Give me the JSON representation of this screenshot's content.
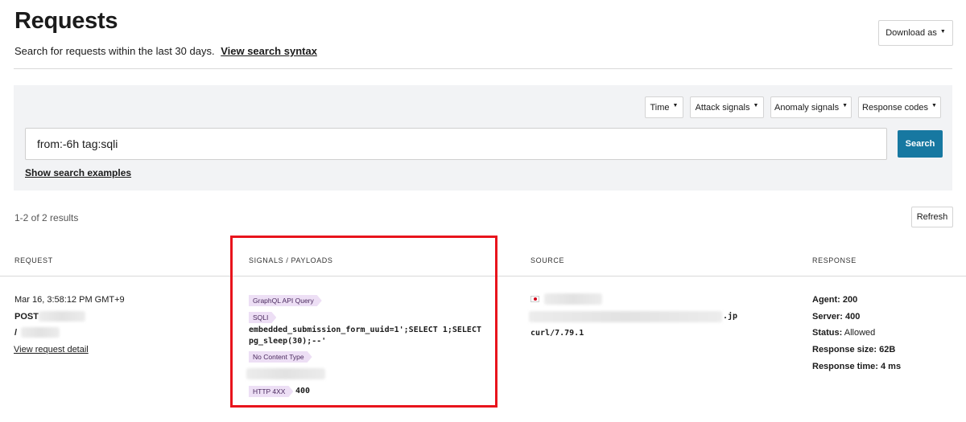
{
  "header": {
    "title": "Requests",
    "subtitle": "Search for requests within the last 30 days.",
    "syntax_link": "View search syntax",
    "download_label": "Download as"
  },
  "filters": {
    "time": "Time",
    "attack": "Attack signals",
    "anomaly": "Anomaly signals",
    "response": "Response codes"
  },
  "search": {
    "value": "from:-6h tag:sqli",
    "button": "Search",
    "examples_link": "Show search examples"
  },
  "results": {
    "count": "1-2 of 2 results",
    "refresh": "Refresh"
  },
  "table": {
    "headers": {
      "request": "REQUEST",
      "signals": "SIGNALS / PAYLOADS",
      "source": "SOURCE",
      "response": "RESPONSE"
    },
    "row": {
      "timestamp": "Mar 16, 3:58:12 PM GMT+9",
      "method": "POST",
      "path": "/",
      "detail_link": "View request detail",
      "signals": {
        "tag_graphql": "GraphQL API Query",
        "tag_sqli": "SQLI",
        "payload": "embedded_submission_form_uuid=1';SELECT 1;SELECT pg_sleep(30);--'",
        "tag_no_content": "No Content Type",
        "tag_http": "HTTP 4XX",
        "http_value": "400"
      },
      "source": {
        "host_suffix": ".jp",
        "user_agent": "curl/7.79.1",
        "flag_icon": "japan-flag-icon"
      },
      "response": {
        "agent_label": "Agent:",
        "agent_value": "200",
        "server_label": "Server:",
        "server_value": "400",
        "status_label": "Status:",
        "status_value": "Allowed",
        "size_label": "Response size:",
        "size_value": "62B",
        "time_label": "Response time:",
        "time_value": "4 ms"
      }
    }
  },
  "colors": {
    "accent": "#1778a1",
    "tag_bg": "#eddff5",
    "highlight": "#e8141c",
    "panel_bg": "#f2f3f5"
  }
}
